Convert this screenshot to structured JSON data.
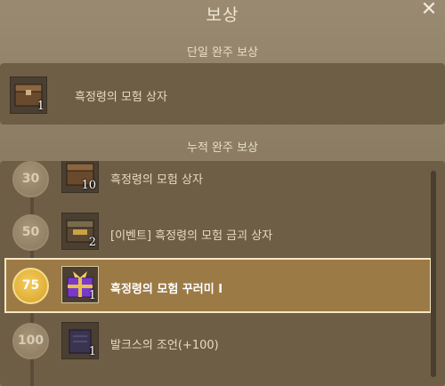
{
  "title": "보상",
  "close_label": "✕",
  "single": {
    "section_label": "단일 완주 보상",
    "item": {
      "name": "흑정령의 모험 상자",
      "qty": "1",
      "icon": "chest-icon"
    }
  },
  "cumulative": {
    "section_label": "누적 완주 보상",
    "rows": [
      {
        "milestone": "30",
        "name": "흑정령의 모험 상자",
        "qty": "10",
        "icon": "chest-icon"
      },
      {
        "milestone": "50",
        "name": "[이벤트] 흑정령의 모험 금괴 상자",
        "qty": "2",
        "icon": "gold-bar-chest-icon"
      },
      {
        "milestone": "75",
        "name": "흑정령의 모험 꾸러미 I",
        "qty": "1",
        "icon": "gift-box-icon",
        "highlighted": true
      },
      {
        "milestone": "100",
        "name": "발크스의 조언(+100)",
        "qty": "1",
        "icon": "scroll-icon"
      }
    ]
  },
  "colors": {
    "highlight": "#9c7a46",
    "highlight_border": "#f6e6c4",
    "coin_gold": "#e3b03c"
  }
}
